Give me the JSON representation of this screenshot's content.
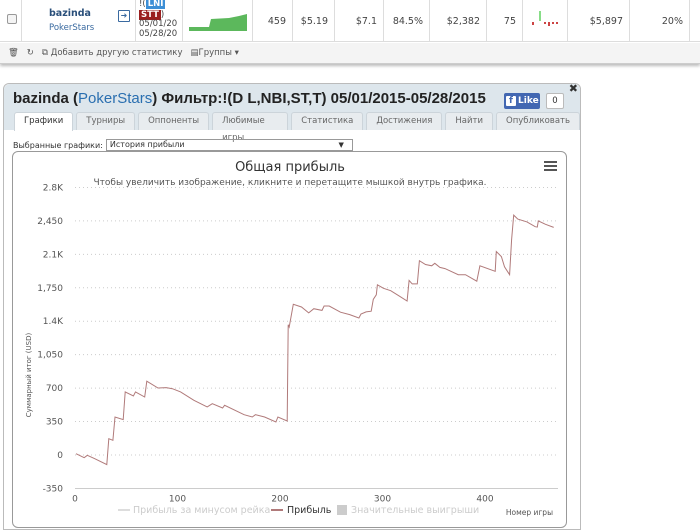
{
  "table_row": {
    "player": "bazinda",
    "site": "PokerStars",
    "filter_prefix": "!(",
    "badge1": "LNI",
    "badge2": "STT",
    "filter_suffix": ")",
    "date_from": "05/01/20",
    "date_to": "05/28/20",
    "values": [
      "459",
      "$5.19",
      "$7.1",
      "84.5%",
      "$2,382",
      "75",
      "$5,897",
      "20%"
    ]
  },
  "toolbar": {
    "add_stat": "Добавить другую статистику",
    "groups": "Группы"
  },
  "popup": {
    "player": "bazinda",
    "open": " (",
    "site": "PokerStars",
    "rest": ") Фильтр:!(D L,NBI,ST,T) 05/01/2015-05/28/2015",
    "like": "Like",
    "like_count": "0",
    "tabs": [
      "Графики",
      "Турниры",
      "Оппоненты",
      "Любимые игры",
      "Статистика",
      "Достижения",
      "Найти",
      "Опубликовать"
    ],
    "selected_label": "Выбранные графики:",
    "selected_value": "История прибыли"
  },
  "colors": {
    "line": "#b07a7a",
    "accent": "#2a6fb0"
  },
  "chart_data": {
    "type": "line",
    "title": "Общая прибыль",
    "subtitle": "Чтобы увеличить изображение, кликните и перетащите мышкой внутрь графика.",
    "xlabel": "Номер игры",
    "ylabel": "Суммарный итог (USD)",
    "xlim": [
      0,
      470
    ],
    "ylim": [
      -350,
      2800
    ],
    "x_ticks": [
      "0",
      "100",
      "200",
      "300",
      "400"
    ],
    "y_ticks": [
      "2.8K",
      "2,450",
      "2.1K",
      "1,750",
      "1.4K",
      "1,050",
      "700",
      "350",
      "0",
      "-350"
    ],
    "legend": [
      "Прибыль за минусом рейка",
      "Прибыль",
      "Значительные выигрыши"
    ],
    "series": [
      {
        "name": "Прибыль",
        "x": [
          1,
          9,
          12,
          19,
          31,
          33,
          37,
          39,
          47,
          49,
          57,
          59,
          68,
          70,
          81,
          89,
          95,
          103,
          116,
          129,
          134,
          144,
          146,
          165,
          173,
          176,
          185,
          196,
          198,
          207,
          208,
          209,
          213,
          221,
          228,
          233,
          241,
          243,
          248,
          259,
          268,
          277,
          279,
          284,
          289,
          291,
          294,
          295,
          301,
          308,
          316,
          324,
          326,
          329,
          334,
          336,
          342,
          348,
          351,
          356,
          361,
          374,
          381,
          392,
          395,
          410,
          411,
          416,
          419,
          424,
          426,
          428,
          432,
          441,
          449,
          451,
          452,
          459,
          467
        ],
        "y": [
          14,
          -28,
          -3,
          -38,
          -101,
          171,
          154,
          398,
          370,
          660,
          618,
          660,
          607,
          772,
          701,
          705,
          694,
          660,
          573,
          503,
          537,
          492,
          520,
          422,
          398,
          422,
          398,
          345,
          398,
          356,
          1364,
          1340,
          1577,
          1549,
          1487,
          1531,
          1513,
          1560,
          1560,
          1495,
          1470,
          1434,
          1476,
          1498,
          1505,
          1630,
          1677,
          1781,
          1745,
          1720,
          1666,
          1612,
          1827,
          1791,
          1791,
          2034,
          1994,
          1980,
          2006,
          1963,
          1951,
          1887,
          1887,
          1819,
          1980,
          1923,
          2130,
          2077,
          1970,
          1887,
          2255,
          2511,
          2469,
          2440,
          2390,
          2385,
          2450,
          2415,
          2382
        ]
      }
    ]
  }
}
